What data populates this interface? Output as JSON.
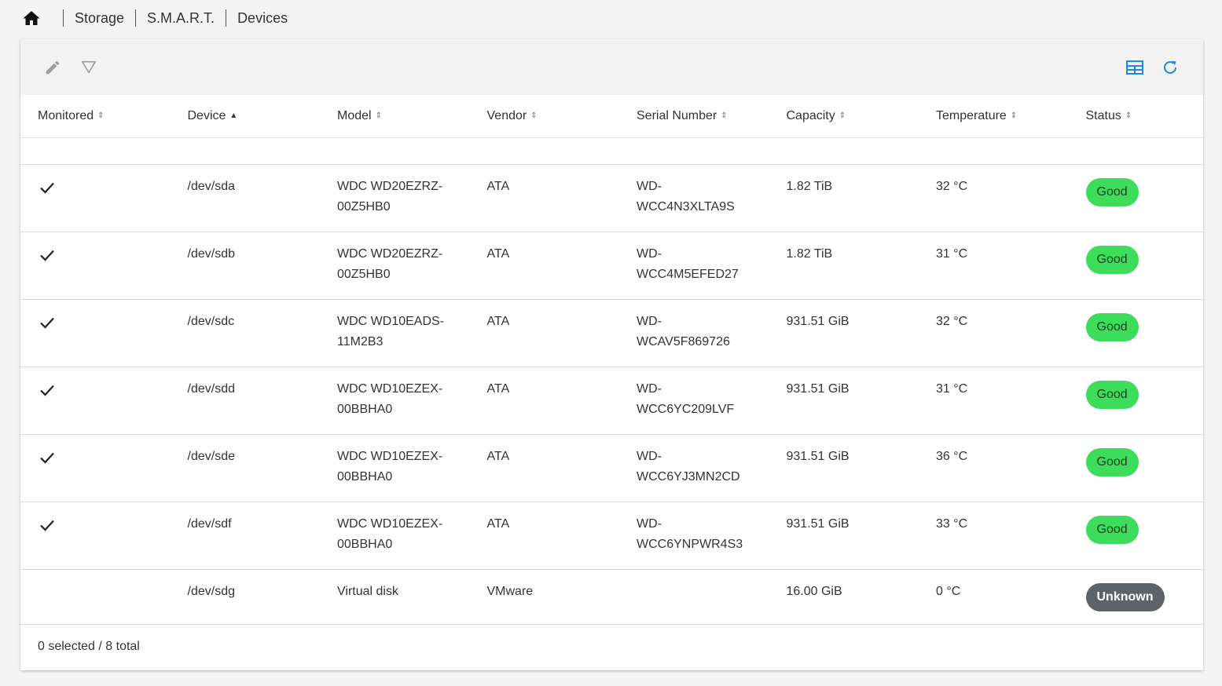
{
  "breadcrumb": {
    "home_icon": "home-icon",
    "items": [
      "Storage",
      "S.M.A.R.T.",
      "Devices"
    ]
  },
  "toolbar": {
    "left_icons": [
      "pencil-icon",
      "filter-icon"
    ],
    "right_icons": [
      "table-columns-icon",
      "refresh-icon"
    ],
    "accent_color": "#1e88e5"
  },
  "table": {
    "columns": [
      "Monitored",
      "Device",
      "Model",
      "Vendor",
      "Serial Number",
      "Capacity",
      "Temperature",
      "Status"
    ],
    "sort": {
      "column": "Device",
      "direction": "asc"
    },
    "rows": [
      {
        "monitored": true,
        "device": "/dev/sda",
        "model_1": "WDC WD20EZRZ-",
        "model_2": "00Z5HB0",
        "vendor": "ATA",
        "serial_1": "WD-",
        "serial_2": "WCC4N3XLTA9S",
        "capacity": "1.82 TiB",
        "temperature": "32 °C",
        "status": "Good"
      },
      {
        "monitored": true,
        "device": "/dev/sdb",
        "model_1": "WDC WD20EZRZ-",
        "model_2": "00Z5HB0",
        "vendor": "ATA",
        "serial_1": "WD-",
        "serial_2": "WCC4M5EFED27",
        "capacity": "1.82 TiB",
        "temperature": "31 °C",
        "status": "Good"
      },
      {
        "monitored": true,
        "device": "/dev/sdc",
        "model_1": "WDC WD10EADS-",
        "model_2": "11M2B3",
        "vendor": "ATA",
        "serial_1": "WD-",
        "serial_2": "WCAV5F869726",
        "capacity": "931.51 GiB",
        "temperature": "32 °C",
        "status": "Good"
      },
      {
        "monitored": true,
        "device": "/dev/sdd",
        "model_1": "WDC WD10EZEX-",
        "model_2": "00BBHA0",
        "vendor": "ATA",
        "serial_1": "WD-",
        "serial_2": "WCC6YC209LVF",
        "capacity": "931.51 GiB",
        "temperature": "31 °C",
        "status": "Good"
      },
      {
        "monitored": true,
        "device": "/dev/sde",
        "model_1": "WDC WD10EZEX-",
        "model_2": "00BBHA0",
        "vendor": "ATA",
        "serial_1": "WD-",
        "serial_2": "WCC6YJ3MN2CD",
        "capacity": "931.51 GiB",
        "temperature": "36 °C",
        "status": "Good"
      },
      {
        "monitored": true,
        "device": "/dev/sdf",
        "model_1": "WDC WD10EZEX-",
        "model_2": "00BBHA0",
        "vendor": "ATA",
        "serial_1": "WD-",
        "serial_2": "WCC6YNPWR4S3",
        "capacity": "931.51 GiB",
        "temperature": "33 °C",
        "status": "Good"
      },
      {
        "monitored": false,
        "device": "/dev/sdg",
        "model_1": "Virtual disk",
        "model_2": "",
        "vendor": "VMware",
        "serial_1": "",
        "serial_2": "",
        "capacity": "16.00 GiB",
        "temperature": "0 °C",
        "status": "Unknown"
      }
    ],
    "status_colors": {
      "Good": "#3ddc5b",
      "Unknown": "#5f6368"
    }
  },
  "footer": {
    "summary": "0 selected / 8 total"
  }
}
